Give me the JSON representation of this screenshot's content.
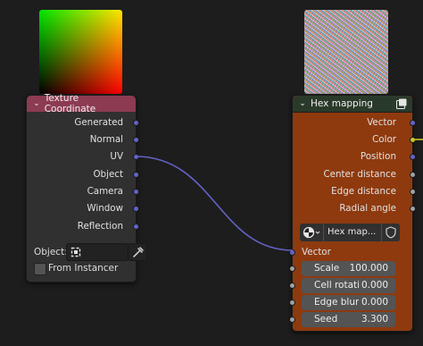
{
  "texture_node": {
    "title": "Texture Coordinate",
    "outputs": [
      "Generated",
      "Normal",
      "UV",
      "Object",
      "Camera",
      "Window",
      "Reflection"
    ],
    "object_label": "Object:",
    "instancer_label": "From Instancer"
  },
  "hex_node": {
    "title": "Hex mapping",
    "outputs": [
      "Vector",
      "Color",
      "Position",
      "Center distance",
      "Edge distance",
      "Radial angle"
    ],
    "image_name": "Hex map...",
    "input_vector_label": "Vector",
    "fields": [
      {
        "label": "Scale",
        "value": "100.000"
      },
      {
        "label": "Cell rotati",
        "value": "0.000"
      },
      {
        "label": "Edge blur",
        "value": "0.000"
      },
      {
        "label": "Seed",
        "value": "3.300"
      }
    ]
  },
  "colors": {
    "vector_socket": "#6363c7",
    "color_socket": "#c7c729",
    "float_socket": "#a1a1a1",
    "texture_header": "#8c3b52",
    "hex_body": "#8e3a0e"
  }
}
